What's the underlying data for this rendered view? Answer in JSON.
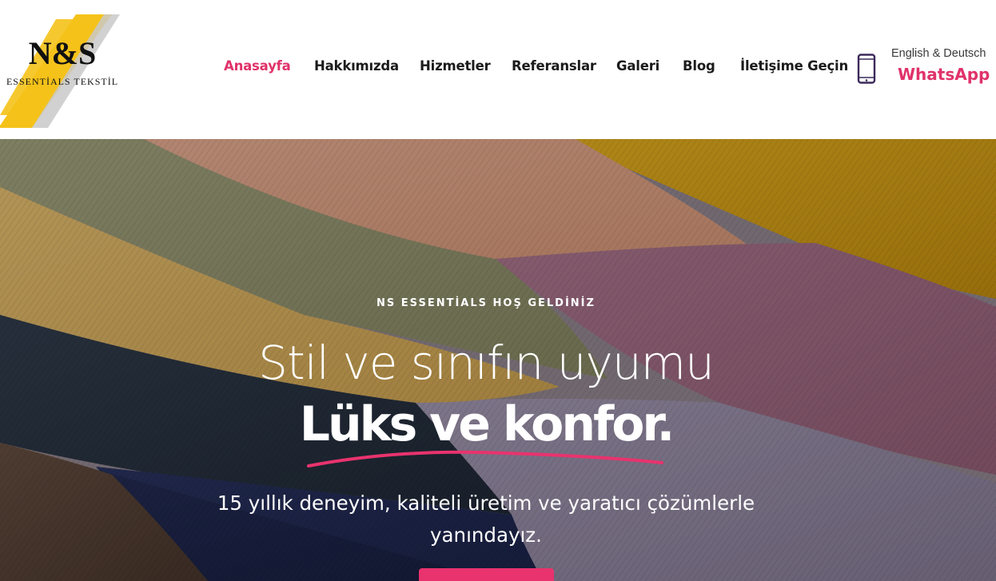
{
  "brand": {
    "logo_mark": "N&S",
    "logo_text": "ESSENTİALS TEKSTİL"
  },
  "nav": {
    "items": [
      {
        "label": "Anasayfa",
        "active": true
      },
      {
        "label": "Hakkımızda",
        "active": false
      },
      {
        "label": "Hizmetler",
        "active": false
      },
      {
        "label": "Referanslar",
        "active": false
      },
      {
        "label": "Galeri",
        "active": false
      },
      {
        "label": "Blog",
        "active": false
      },
      {
        "label": "İletişime Geçin",
        "active": false
      }
    ]
  },
  "contact": {
    "icon": "phone-icon",
    "lang_label": "English & Deutsch",
    "whatsapp_label": "WhatsApp"
  },
  "hero": {
    "kicker": "NS ESSENTİALS HOŞ GELDİNİZ",
    "line1": "Stil ve sınıfın uyumu",
    "line2": "Lüks ve konfor.",
    "subtitle": "15 yıllık deneyim, kaliteli üretim ve yaratıcı çözümlerle yanındayız."
  },
  "colors": {
    "accent": "#e0326a",
    "nav_text": "#1b1b1b"
  }
}
